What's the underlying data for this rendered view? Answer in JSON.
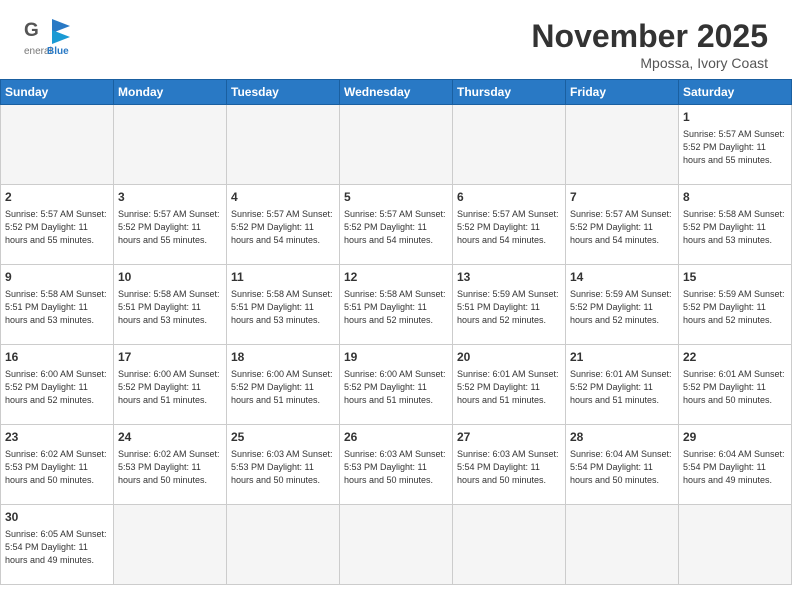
{
  "header": {
    "title": "November 2025",
    "location": "Mpossa, Ivory Coast",
    "logo_general": "General",
    "logo_blue": "Blue"
  },
  "days_of_week": [
    "Sunday",
    "Monday",
    "Tuesday",
    "Wednesday",
    "Thursday",
    "Friday",
    "Saturday"
  ],
  "weeks": [
    [
      {
        "day": null,
        "info": null
      },
      {
        "day": null,
        "info": null
      },
      {
        "day": null,
        "info": null
      },
      {
        "day": null,
        "info": null
      },
      {
        "day": null,
        "info": null
      },
      {
        "day": null,
        "info": null
      },
      {
        "day": "1",
        "info": "Sunrise: 5:57 AM\nSunset: 5:52 PM\nDaylight: 11 hours\nand 55 minutes."
      }
    ],
    [
      {
        "day": "2",
        "info": "Sunrise: 5:57 AM\nSunset: 5:52 PM\nDaylight: 11 hours\nand 55 minutes."
      },
      {
        "day": "3",
        "info": "Sunrise: 5:57 AM\nSunset: 5:52 PM\nDaylight: 11 hours\nand 55 minutes."
      },
      {
        "day": "4",
        "info": "Sunrise: 5:57 AM\nSunset: 5:52 PM\nDaylight: 11 hours\nand 54 minutes."
      },
      {
        "day": "5",
        "info": "Sunrise: 5:57 AM\nSunset: 5:52 PM\nDaylight: 11 hours\nand 54 minutes."
      },
      {
        "day": "6",
        "info": "Sunrise: 5:57 AM\nSunset: 5:52 PM\nDaylight: 11 hours\nand 54 minutes."
      },
      {
        "day": "7",
        "info": "Sunrise: 5:57 AM\nSunset: 5:52 PM\nDaylight: 11 hours\nand 54 minutes."
      },
      {
        "day": "8",
        "info": "Sunrise: 5:58 AM\nSunset: 5:52 PM\nDaylight: 11 hours\nand 53 minutes."
      }
    ],
    [
      {
        "day": "9",
        "info": "Sunrise: 5:58 AM\nSunset: 5:51 PM\nDaylight: 11 hours\nand 53 minutes."
      },
      {
        "day": "10",
        "info": "Sunrise: 5:58 AM\nSunset: 5:51 PM\nDaylight: 11 hours\nand 53 minutes."
      },
      {
        "day": "11",
        "info": "Sunrise: 5:58 AM\nSunset: 5:51 PM\nDaylight: 11 hours\nand 53 minutes."
      },
      {
        "day": "12",
        "info": "Sunrise: 5:58 AM\nSunset: 5:51 PM\nDaylight: 11 hours\nand 52 minutes."
      },
      {
        "day": "13",
        "info": "Sunrise: 5:59 AM\nSunset: 5:51 PM\nDaylight: 11 hours\nand 52 minutes."
      },
      {
        "day": "14",
        "info": "Sunrise: 5:59 AM\nSunset: 5:52 PM\nDaylight: 11 hours\nand 52 minutes."
      },
      {
        "day": "15",
        "info": "Sunrise: 5:59 AM\nSunset: 5:52 PM\nDaylight: 11 hours\nand 52 minutes."
      }
    ],
    [
      {
        "day": "16",
        "info": "Sunrise: 6:00 AM\nSunset: 5:52 PM\nDaylight: 11 hours\nand 52 minutes."
      },
      {
        "day": "17",
        "info": "Sunrise: 6:00 AM\nSunset: 5:52 PM\nDaylight: 11 hours\nand 51 minutes."
      },
      {
        "day": "18",
        "info": "Sunrise: 6:00 AM\nSunset: 5:52 PM\nDaylight: 11 hours\nand 51 minutes."
      },
      {
        "day": "19",
        "info": "Sunrise: 6:00 AM\nSunset: 5:52 PM\nDaylight: 11 hours\nand 51 minutes."
      },
      {
        "day": "20",
        "info": "Sunrise: 6:01 AM\nSunset: 5:52 PM\nDaylight: 11 hours\nand 51 minutes."
      },
      {
        "day": "21",
        "info": "Sunrise: 6:01 AM\nSunset: 5:52 PM\nDaylight: 11 hours\nand 51 minutes."
      },
      {
        "day": "22",
        "info": "Sunrise: 6:01 AM\nSunset: 5:52 PM\nDaylight: 11 hours\nand 50 minutes."
      }
    ],
    [
      {
        "day": "23",
        "info": "Sunrise: 6:02 AM\nSunset: 5:53 PM\nDaylight: 11 hours\nand 50 minutes."
      },
      {
        "day": "24",
        "info": "Sunrise: 6:02 AM\nSunset: 5:53 PM\nDaylight: 11 hours\nand 50 minutes."
      },
      {
        "day": "25",
        "info": "Sunrise: 6:03 AM\nSunset: 5:53 PM\nDaylight: 11 hours\nand 50 minutes."
      },
      {
        "day": "26",
        "info": "Sunrise: 6:03 AM\nSunset: 5:53 PM\nDaylight: 11 hours\nand 50 minutes."
      },
      {
        "day": "27",
        "info": "Sunrise: 6:03 AM\nSunset: 5:54 PM\nDaylight: 11 hours\nand 50 minutes."
      },
      {
        "day": "28",
        "info": "Sunrise: 6:04 AM\nSunset: 5:54 PM\nDaylight: 11 hours\nand 50 minutes."
      },
      {
        "day": "29",
        "info": "Sunrise: 6:04 AM\nSunset: 5:54 PM\nDaylight: 11 hours\nand 49 minutes."
      }
    ],
    [
      {
        "day": "30",
        "info": "Sunrise: 6:05 AM\nSunset: 5:54 PM\nDaylight: 11 hours\nand 49 minutes."
      },
      {
        "day": null,
        "info": null
      },
      {
        "day": null,
        "info": null
      },
      {
        "day": null,
        "info": null
      },
      {
        "day": null,
        "info": null
      },
      {
        "day": null,
        "info": null
      },
      {
        "day": null,
        "info": null
      }
    ]
  ]
}
